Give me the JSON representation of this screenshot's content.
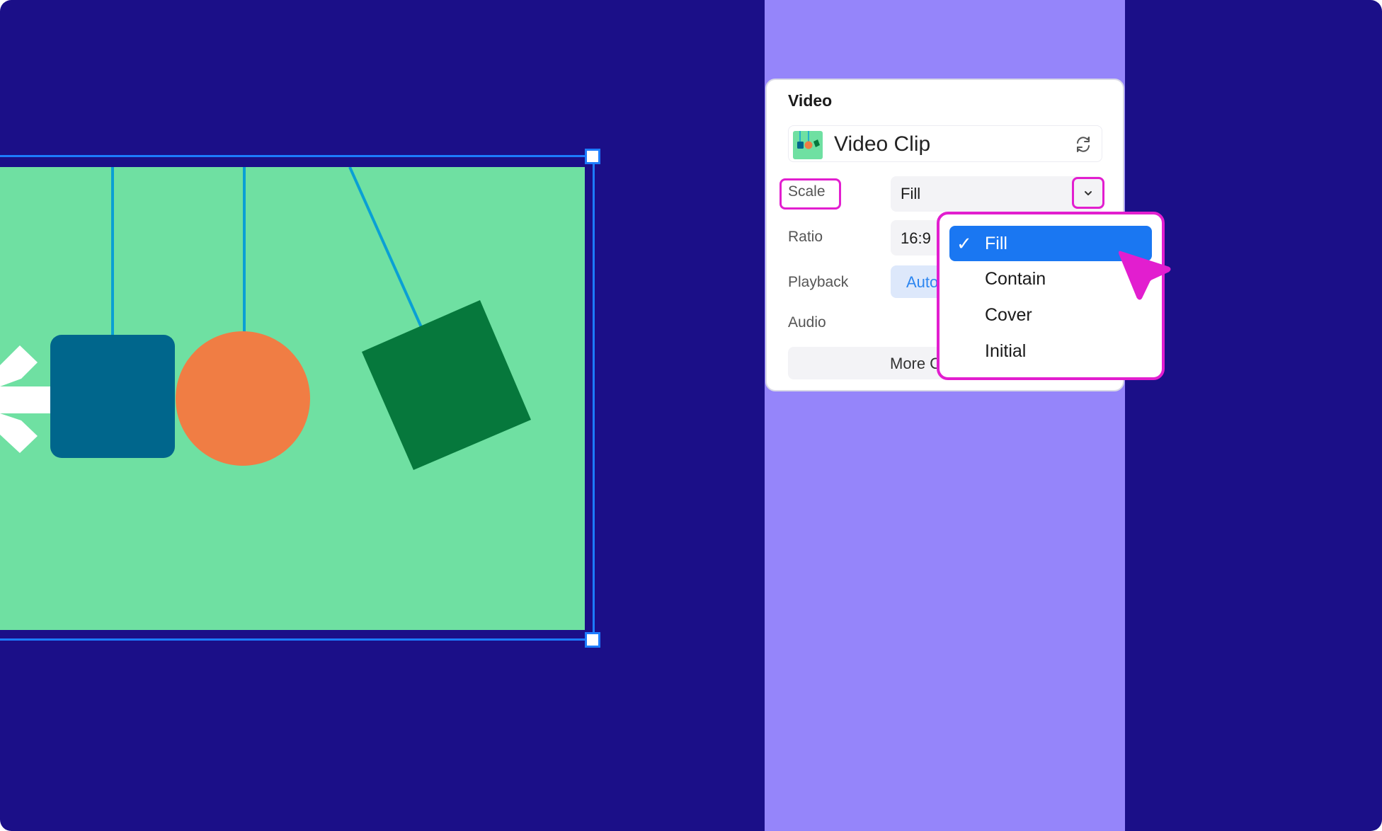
{
  "panel": {
    "title": "Video",
    "clip": {
      "name": "Video Clip"
    },
    "rows": {
      "scale": {
        "label": "Scale",
        "value": "Fill"
      },
      "ratio": {
        "label": "Ratio",
        "value": "16:9"
      },
      "playback": {
        "label": "Playback",
        "value": "Auto"
      },
      "audio": {
        "label": "Audio"
      }
    },
    "more_button": "More O"
  },
  "dropdown": {
    "options": [
      {
        "label": "Fill",
        "selected": true
      },
      {
        "label": "Contain",
        "selected": false
      },
      {
        "label": "Cover",
        "selected": false
      },
      {
        "label": "Initial",
        "selected": false
      }
    ],
    "check_glyph": "✓"
  },
  "colors": {
    "background": "#1b0f88",
    "strip": "#9585fa",
    "video_bg": "#6fe0a2",
    "selection": "#1d7cff",
    "highlight": "#e21ecf",
    "accent": "#1a77f2"
  },
  "icons": [
    "swap-icon",
    "chevron-down-icon",
    "check-icon",
    "cursor-pointer-icon"
  ]
}
